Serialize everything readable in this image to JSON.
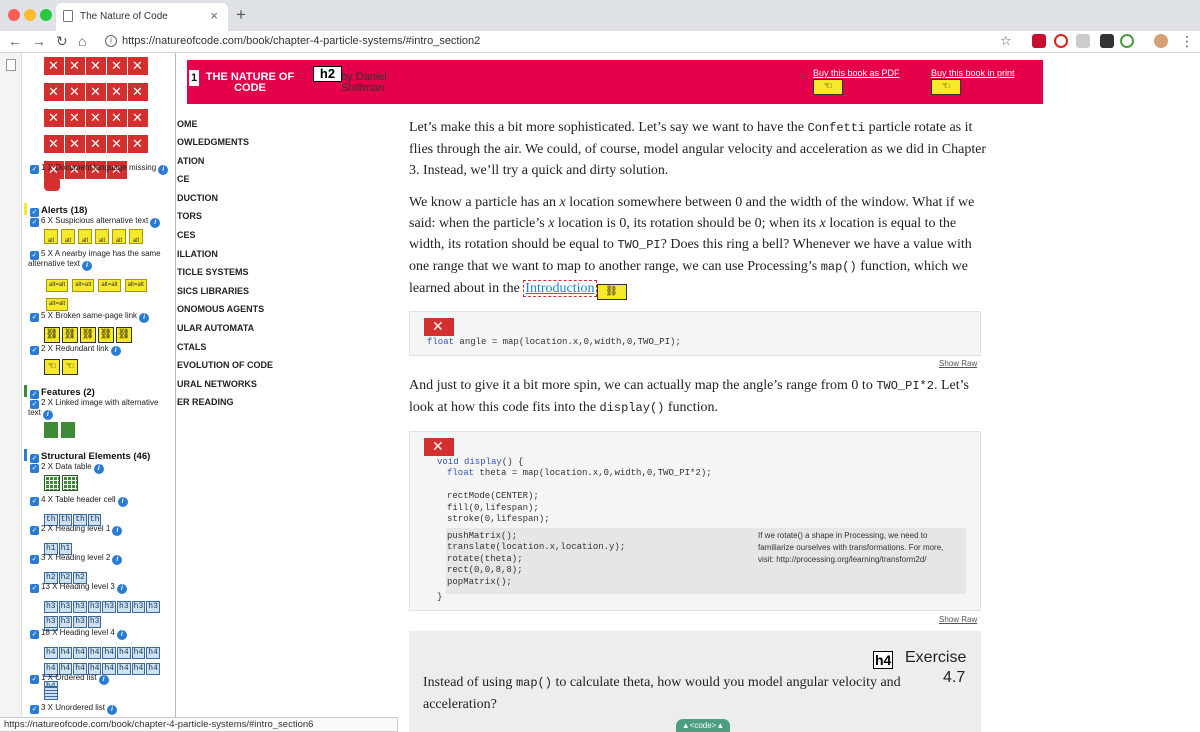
{
  "browser": {
    "tab_title": "The Nature of Code",
    "url": "https://natureofcode.com/book/chapter-4-particle-systems/#intro_section2",
    "status_url": "https://natureofcode.com/book/chapter-4-particle-systems/#intro_section6"
  },
  "wave": {
    "doc_lang": "1 X Document language missing",
    "alerts_head": "Alerts (18)",
    "alt_suspicious": "6 X Suspicious alternative text",
    "alt_icon_label": "alt",
    "nearby_image_line1": "5 X A nearby image has the same",
    "nearby_image_line2": "alternative text",
    "altalt_label": "alt=alt",
    "broken_link": "5 X Broken same-page link",
    "redundant_link": "2 X Redundant link",
    "features_head": "Features (2)",
    "linked_image_line1": "2 X Linked image with alternative",
    "linked_image_line2": "text",
    "structural_head": "Structural Elements (46)",
    "data_table": "2 X Data table",
    "table_header": "4 X Table header cell",
    "th_label": "th",
    "h1_item": "2 X Heading level 1",
    "h1_label": "h1",
    "h2_item": "3 X Heading level 2",
    "h2_label": "h2",
    "h3_item": "13 X Heading level 3",
    "h3_label": "h3",
    "h4_item": "18 X Heading level 4",
    "h4_label": "h4",
    "ol_item": "1 X Ordered list",
    "ul_item": "3 X Unordered list"
  },
  "header": {
    "h1_badge": "1",
    "logo_line1": "THE NATURE OF",
    "logo_line2": "CODE",
    "h2_badge": "h2",
    "author_line1": "by Daniel",
    "author_line2": "Shiffman",
    "buy_pdf": "Buy this book as PDF",
    "buy_print": "Buy this book in print"
  },
  "toc": [
    "OME",
    "OWLEDGMENTS",
    "ATION",
    "CE",
    "DUCTION",
    "TORS",
    "CES",
    "ILLATION",
    "TICLE SYSTEMS",
    "SICS LIBRARIES",
    "ONOMOUS AGENTS",
    "ULAR AUTOMATA",
    "CTALS",
    "EVOLUTION OF CODE",
    "URAL NETWORKS",
    "ER READING"
  ],
  "content": {
    "p1a": "Let’s make this a bit more sophisticated. Let’s say we want to have the ",
    "p1_code": "Confetti",
    "p1b": " particle rotate as it flies through the air. We could, of course, model angular velocity and acceleration as we did in Chapter 3. Instead, we’ll try a quick and dirty solution.",
    "p2a": "We know a particle has an ",
    "p2_x1": "x",
    "p2b": " location somewhere between 0 and the width of the window. What if we said: when the particle’s ",
    "p2_x2": "x",
    "p2c": " location is 0, its rotation should be 0; when its ",
    "p2_x3": "x",
    "p2d": " location is equal to the width, its rotation should be equal to ",
    "p2_code1": "TWO_PI",
    "p2e": "? Does this ring a bell? Whenever we have a value with one range that we want to map to another range, we can use Processing’s ",
    "p2_code2": "map()",
    "p2f": " function, which we learned about in the ",
    "p2_link": "Introduction",
    "code1_kw": "float",
    "code1_rest": " angle = map(location.x,0,width,0,TWO_PI);",
    "show_raw": "Show Raw",
    "p3a": "And just to give it a bit more spin, we can actually map the angle’s range from 0 to ",
    "p3_code1": "TWO_PI*2",
    "p3b": ". Let’s look at how this code fits into the ",
    "p3_code2": "display()",
    "p3c": " function.",
    "code2_void": "void",
    "code2_fn": " display",
    "code2_l1_rest": "() {",
    "code2_float": "float",
    "code2_l2_rest": " theta = map(location.x,0,width,0,TWO_PI*2);",
    "code2_l3": "rectMode(CENTER);",
    "code2_l4": "fill(0,lifespan);",
    "code2_l5": "stroke(0,lifespan);",
    "code2_l6": "pushMatrix();",
    "code2_l7": "translate(location.x,location.y);",
    "code2_l8": "rotate(theta);",
    "code2_l9": "rect(0,0,8,8);",
    "code2_l10": "popMatrix();",
    "code2_close": "}",
    "note_line1": "If we rotate() a shape in Processing, we need to",
    "note_line2": "familiarize ourselves with transformations. For more,",
    "note_line3": "visit: http://processing.org/learning/transform2d/",
    "exercise_h4": "h4",
    "exercise_title": "Exercise",
    "exercise_num": "4.7",
    "ex_a": "Instead of using ",
    "ex_code": "map()",
    "ex_b": " to calculate theta, how would you model angular velocity and acceleration?",
    "code_toggle": "▲<code>▲"
  }
}
